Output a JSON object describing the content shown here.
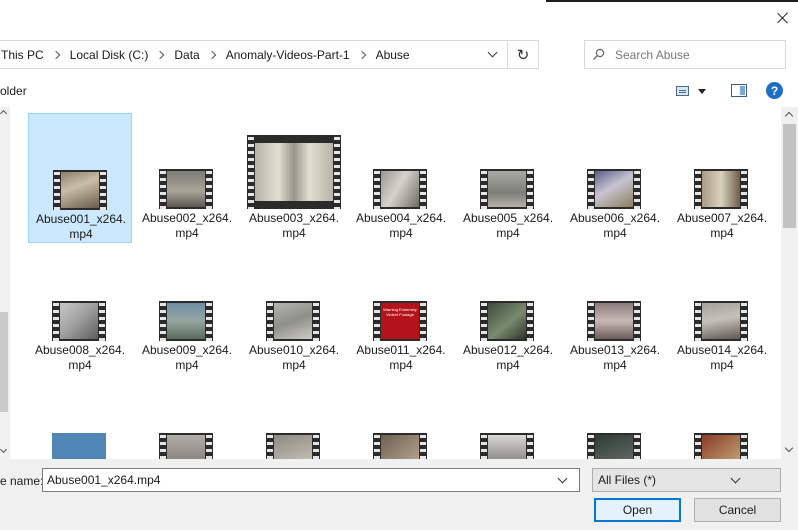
{
  "window": {
    "close_label": "✕"
  },
  "address_bar": {
    "breadcrumbs": [
      "This PC",
      "Local Disk (C:)",
      "Data",
      "Anomaly-Videos-Part-1",
      "Abuse"
    ]
  },
  "search": {
    "placeholder": "Search Abuse"
  },
  "toolbar": {
    "new_folder_label": "older",
    "help_label": "?"
  },
  "files": [
    {
      "line1": "Abuse001_x264.",
      "line2": "mp4",
      "selected": true
    },
    {
      "line1": "Abuse002_x264.",
      "line2": "mp4"
    },
    {
      "line1": "Abuse003_x264.",
      "line2": "mp4"
    },
    {
      "line1": "Abuse004_x264.",
      "line2": "mp4"
    },
    {
      "line1": "Abuse005_x264.",
      "line2": "mp4"
    },
    {
      "line1": "Abuse006_x264.",
      "line2": "mp4"
    },
    {
      "line1": "Abuse007_x264.",
      "line2": "mp4"
    },
    {
      "line1": "Abuse008_x264.",
      "line2": "mp4"
    },
    {
      "line1": "Abuse009_x264.",
      "line2": "mp4"
    },
    {
      "line1": "Abuse010_x264.",
      "line2": "mp4"
    },
    {
      "line1": "Abuse011_x264.",
      "line2": "mp4",
      "thumb_text": "Warning Extremely Violent Footage"
    },
    {
      "line1": "Abuse012_x264.",
      "line2": "mp4"
    },
    {
      "line1": "Abuse013_x264.",
      "line2": "mp4"
    },
    {
      "line1": "Abuse014_x264.",
      "line2": "mp4"
    }
  ],
  "bottom": {
    "file_name_label": "e name:",
    "file_name_value": "Abuse001_x264.mp4",
    "file_type_value": "All Files (*)",
    "open_label": "Open",
    "cancel_label": "Cancel"
  },
  "colors": {
    "selection_bg": "#cce8ff",
    "selection_border": "#99d1ff",
    "primary_button_border": "#0078d7",
    "help_icon": "#1f6fc5"
  }
}
